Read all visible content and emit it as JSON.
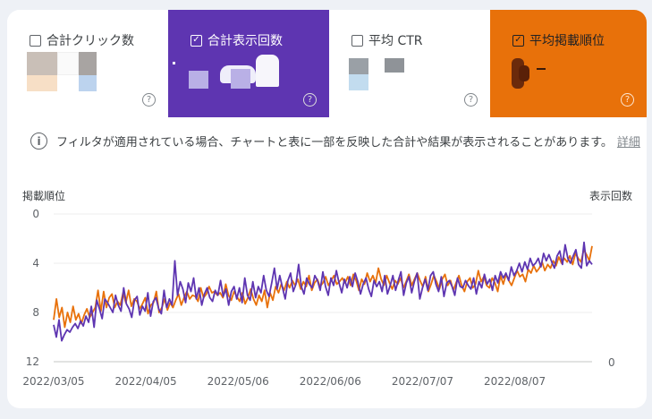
{
  "metrics": [
    {
      "label": "合計クリック数",
      "checked": false,
      "color": "#ffffff"
    },
    {
      "label": "合計表示回数",
      "checked": true,
      "color": "#5e35b1"
    },
    {
      "label": "平均 CTR",
      "checked": false,
      "color": "#ffffff"
    },
    {
      "label": "平均掲載順位",
      "checked": true,
      "color": "#e8710a"
    }
  ],
  "help_glyph": "?",
  "check_glyph": "✓",
  "notice": {
    "text": "フィルタが適用されている場合、チャートと表に一部を反映した合計や結果が表示されることがあります。",
    "link": "詳細",
    "icon": "info-icon"
  },
  "chart_data": {
    "type": "line",
    "ylabel_left": "掲載順位",
    "ylabel_right": "表示回数",
    "y_left_ticks": [
      "0",
      "4",
      "8",
      "12"
    ],
    "y_right_ticks": [
      "0"
    ],
    "y_left_range": [
      0,
      12
    ],
    "y_left_inverted": true,
    "x_tick_labels": [
      "2022/03/05",
      "2022/04/05",
      "2022/05/06",
      "2022/06/06",
      "2022/07/07",
      "2022/08/07"
    ],
    "x_start": "2022-03-05",
    "x_end": "2022-09-02",
    "series": [
      {
        "color": "#e8710a",
        "axis": "left",
        "values": [
          8.6,
          6.9,
          8.4,
          7.6,
          9.2,
          8.0,
          8.8,
          7.5,
          8.6,
          8.1,
          8.9,
          8.2,
          7.7,
          8.4,
          8.0,
          7.6,
          6.2,
          7.9,
          6.3,
          7.6,
          6.8,
          6.5,
          7.6,
          7.1,
          7.4,
          6.4,
          7.2,
          6.2,
          7.5,
          6.9,
          7.1,
          7.7,
          7.3,
          6.8,
          8.1,
          7.4,
          7.2,
          6.3,
          8.0,
          7.6,
          6.9,
          7.8,
          7.2,
          7.6,
          7.0,
          6.5,
          7.4,
          6.8,
          6.3,
          6.9,
          6.6,
          6.7,
          7.1,
          6.0,
          6.8,
          6.5,
          5.9,
          6.4,
          6.3,
          6.6,
          6.4,
          6.8,
          5.7,
          6.6,
          7.0,
          6.3,
          6.7,
          7.1,
          6.4,
          7.3,
          6.8,
          6.1,
          6.9,
          7.4,
          6.6,
          7.1,
          6.2,
          7.6,
          6.4,
          7.0,
          5.9,
          6.4,
          5.7,
          6.2,
          5.5,
          6.0,
          5.4,
          5.8,
          5.3,
          6.1,
          5.5,
          5.9,
          5.0,
          6.2,
          5.6,
          5.3,
          5.9,
          5.6,
          5.1,
          5.8,
          5.4,
          5.0,
          5.7,
          5.5,
          5.2,
          5.6,
          5.1,
          5.8,
          4.9,
          5.4,
          6.2,
          5.3,
          5.7,
          4.8,
          5.5,
          5.0,
          5.6,
          4.4,
          5.3,
          5.8,
          5.0,
          5.6,
          6.1,
          5.4,
          5.7,
          5.2,
          6.0,
          5.5,
          4.9,
          5.8,
          5.3,
          4.8,
          5.4,
          5.9,
          5.1,
          6.3,
          5.7,
          5.0,
          5.5,
          6.1,
          5.3,
          4.9,
          5.8,
          5.4,
          6.2,
          5.6,
          5.0,
          5.8,
          6.3,
          5.5,
          5.2,
          6.0,
          5.7,
          4.6,
          5.5,
          5.1,
          5.8,
          6.0,
          5.2,
          5.6,
          6.3,
          5.0,
          5.7,
          4.9,
          5.4,
          5.8,
          5.2,
          4.6,
          5.1,
          4.9,
          5.5,
          4.5,
          4.8,
          4.2,
          4.7,
          4.4,
          3.9,
          4.6,
          4.1,
          4.4,
          3.8,
          4.2,
          3.5,
          4.0,
          3.6,
          3.9,
          3.4,
          4.1,
          3.2,
          3.6,
          3.9,
          2.9,
          3.3,
          3.8,
          2.6
        ]
      },
      {
        "color": "#5e35b1",
        "axis": "right",
        "values": [
          9.0,
          10.0,
          8.6,
          10.3,
          9.8,
          9.4,
          9.6,
          9.2,
          8.9,
          9.3,
          8.7,
          9.1,
          8.3,
          8.8,
          7.5,
          9.2,
          7.0,
          7.7,
          8.5,
          6.9,
          7.2,
          7.6,
          8.0,
          6.6,
          7.4,
          7.9,
          6.0,
          7.3,
          7.7,
          8.4,
          7.0,
          6.7,
          8.2,
          7.5,
          7.9,
          6.4,
          8.3,
          7.1,
          6.8,
          7.7,
          8.1,
          6.2,
          7.6,
          6.9,
          7.4,
          3.8,
          6.6,
          5.5,
          6.1,
          7.2,
          5.6,
          6.3,
          5.2,
          6.9,
          6.0,
          7.4,
          6.5,
          6.0,
          6.8,
          7.1,
          6.2,
          6.6,
          5.4,
          6.7,
          6.1,
          7.4,
          6.3,
          5.9,
          6.9,
          6.0,
          7.2,
          5.2,
          6.6,
          7.0,
          5.5,
          6.8,
          5.9,
          6.4,
          5.0,
          6.2,
          6.7,
          5.6,
          4.4,
          6.1,
          5.0,
          6.0,
          6.9,
          5.4,
          4.8,
          6.3,
          5.7,
          4.1,
          5.9,
          6.5,
          5.2,
          5.7,
          6.0,
          5.0,
          5.4,
          6.2,
          4.7,
          5.9,
          6.6,
          5.2,
          5.8,
          4.6,
          5.6,
          6.4,
          5.3,
          6.0,
          5.1,
          5.9,
          4.8,
          5.5,
          6.5,
          5.7,
          5.2,
          6.1,
          6.7,
          5.4,
          5.9,
          5.5,
          6.3,
          5.0,
          6.5,
          5.8,
          5.0,
          6.2,
          5.4,
          4.7,
          6.6,
          5.6,
          5.1,
          6.4,
          5.5,
          4.8,
          6.9,
          6.0,
          5.3,
          6.2,
          5.0,
          4.7,
          5.7,
          6.3,
          5.1,
          6.7,
          5.6,
          5.4,
          5.9,
          6.6,
          5.2,
          5.9,
          6.0,
          5.4,
          5.8,
          6.1,
          5.2,
          6.5,
          5.5,
          6.0,
          4.9,
          5.7,
          5.3,
          6.2,
          5.0,
          5.6,
          4.7,
          5.2,
          4.8,
          5.4,
          4.3,
          5.0,
          4.6,
          4.0,
          4.7,
          3.9,
          4.5,
          3.6,
          4.2,
          4.0,
          3.6,
          4.3,
          3.2,
          3.8,
          3.3,
          3.9,
          4.4,
          3.4,
          3.0,
          4.1,
          2.5,
          3.6,
          4.0,
          3.4,
          2.9,
          4.1,
          4.4,
          2.3,
          4.2,
          3.8,
          4.1
        ]
      }
    ]
  }
}
